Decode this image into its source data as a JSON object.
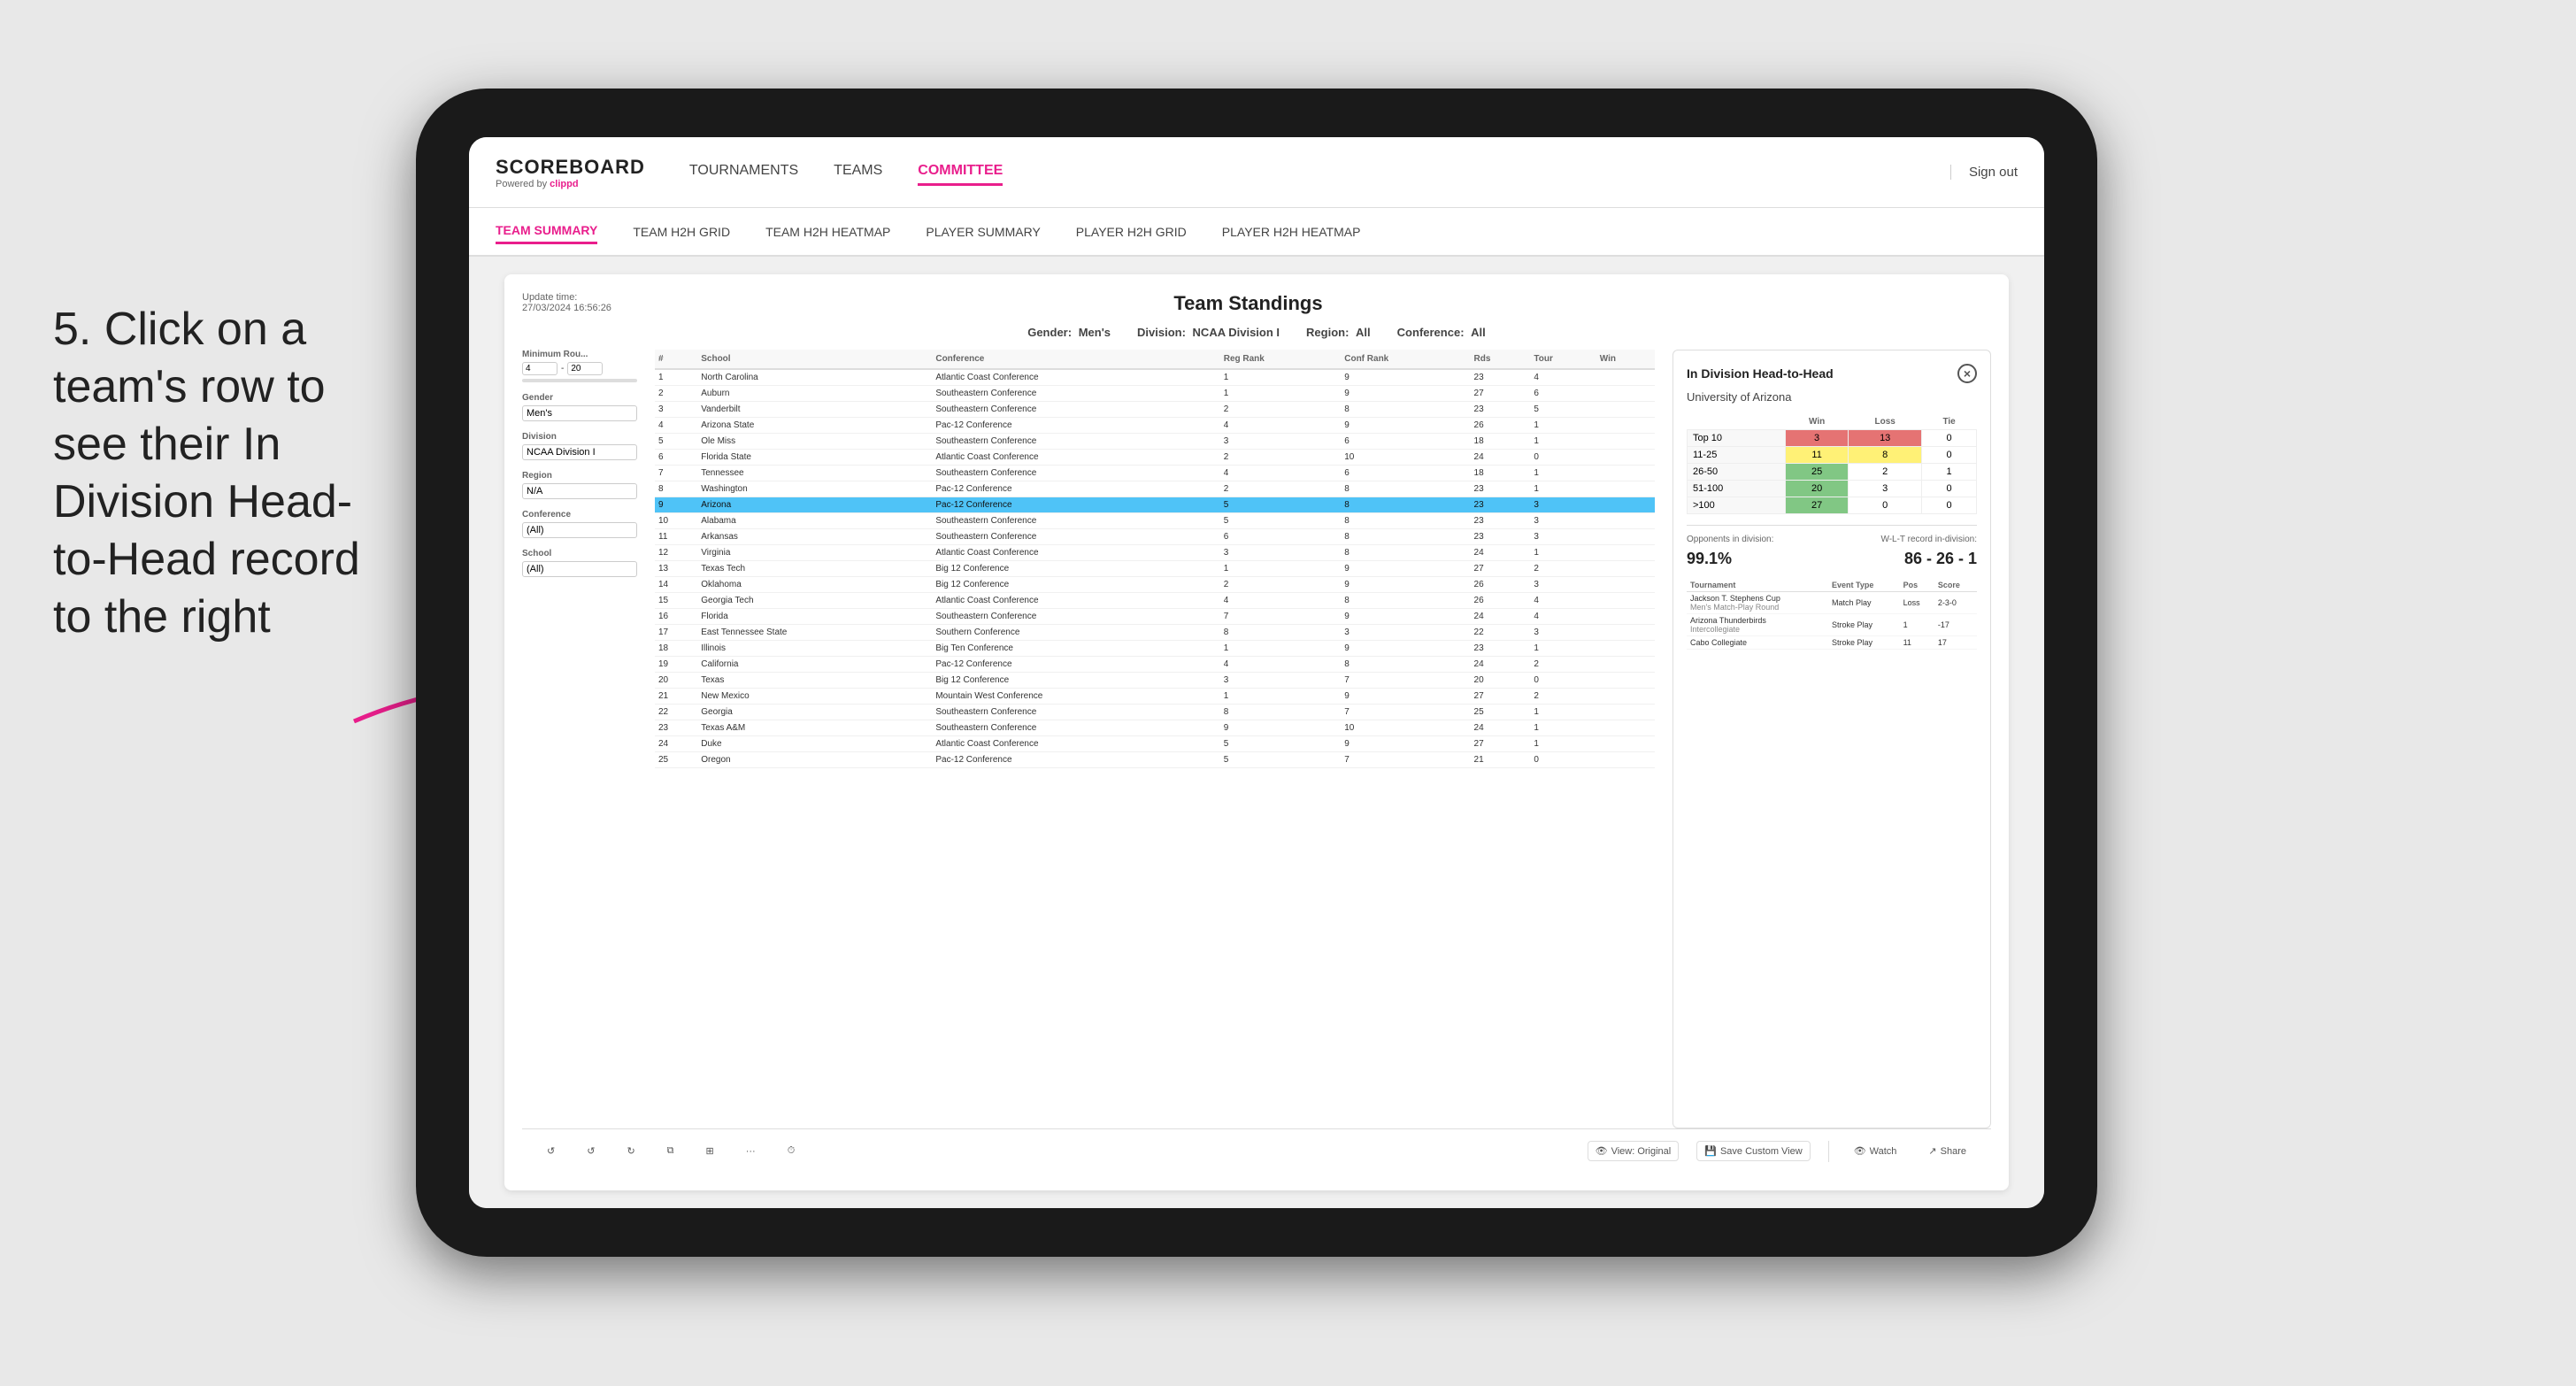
{
  "page": {
    "background_color": "#e8e8e8"
  },
  "instruction": {
    "text": "5. Click on a team's row to see their In Division Head-to-Head record to the right"
  },
  "app": {
    "logo": {
      "title": "SCOREBOARD",
      "subtitle": "Powered by clippd"
    },
    "nav": {
      "items": [
        {
          "label": "TOURNAMENTS",
          "active": false
        },
        {
          "label": "TEAMS",
          "active": false
        },
        {
          "label": "COMMITTEE",
          "active": true
        }
      ],
      "sign_out": "Sign out"
    },
    "sub_nav": {
      "items": [
        {
          "label": "TEAM SUMMARY",
          "active": true
        },
        {
          "label": "TEAM H2H GRID",
          "active": false
        },
        {
          "label": "TEAM H2H HEATMAP",
          "active": false
        },
        {
          "label": "PLAYER SUMMARY",
          "active": false
        },
        {
          "label": "PLAYER H2H GRID",
          "active": false
        },
        {
          "label": "PLAYER H2H HEATMAP",
          "active": false
        }
      ]
    }
  },
  "content": {
    "update_time_label": "Update time:",
    "update_time": "27/03/2024 16:56:26",
    "title": "Team Standings",
    "filters": {
      "gender_label": "Gender:",
      "gender": "Men's",
      "division_label": "Division:",
      "division": "NCAA Division I",
      "region_label": "Region:",
      "region": "All",
      "conference_label": "Conference:",
      "conference": "All"
    },
    "sidebar": {
      "min_rounds_label": "Minimum Rou...",
      "min_rounds_value": "4",
      "min_rounds_max": "20",
      "gender_label": "Gender",
      "gender_value": "Men's",
      "division_label": "Division",
      "division_value": "NCAA Division I",
      "region_label": "Region",
      "region_value": "N/A",
      "conference_label": "Conference",
      "conference_value": "(All)",
      "school_label": "School",
      "school_value": "(All)"
    },
    "table": {
      "headers": [
        "#",
        "School",
        "Conference",
        "Reg Rank",
        "Conf Rank",
        "Rds",
        "Tour",
        "Win"
      ],
      "rows": [
        {
          "num": "1",
          "school": "North Carolina",
          "conference": "Atlantic Coast Conference",
          "reg_rank": "1",
          "conf_rank": "9",
          "rds": "23",
          "tour": "4",
          "win": "",
          "highlighted": false
        },
        {
          "num": "2",
          "school": "Auburn",
          "conference": "Southeastern Conference",
          "reg_rank": "1",
          "conf_rank": "9",
          "rds": "27",
          "tour": "6",
          "win": "",
          "highlighted": false
        },
        {
          "num": "3",
          "school": "Vanderbilt",
          "conference": "Southeastern Conference",
          "reg_rank": "2",
          "conf_rank": "8",
          "rds": "23",
          "tour": "5",
          "win": "",
          "highlighted": false
        },
        {
          "num": "4",
          "school": "Arizona State",
          "conference": "Pac-12 Conference",
          "reg_rank": "4",
          "conf_rank": "9",
          "rds": "26",
          "tour": "1",
          "win": "",
          "highlighted": false
        },
        {
          "num": "5",
          "school": "Ole Miss",
          "conference": "Southeastern Conference",
          "reg_rank": "3",
          "conf_rank": "6",
          "rds": "18",
          "tour": "1",
          "win": "",
          "highlighted": false
        },
        {
          "num": "6",
          "school": "Florida State",
          "conference": "Atlantic Coast Conference",
          "reg_rank": "2",
          "conf_rank": "10",
          "rds": "24",
          "tour": "0",
          "win": "",
          "highlighted": false
        },
        {
          "num": "7",
          "school": "Tennessee",
          "conference": "Southeastern Conference",
          "reg_rank": "4",
          "conf_rank": "6",
          "rds": "18",
          "tour": "1",
          "win": "",
          "highlighted": false
        },
        {
          "num": "8",
          "school": "Washington",
          "conference": "Pac-12 Conference",
          "reg_rank": "2",
          "conf_rank": "8",
          "rds": "23",
          "tour": "1",
          "win": "",
          "highlighted": false
        },
        {
          "num": "9",
          "school": "Arizona",
          "conference": "Pac-12 Conference",
          "reg_rank": "5",
          "conf_rank": "8",
          "rds": "23",
          "tour": "3",
          "win": "",
          "highlighted": true
        },
        {
          "num": "10",
          "school": "Alabama",
          "conference": "Southeastern Conference",
          "reg_rank": "5",
          "conf_rank": "8",
          "rds": "23",
          "tour": "3",
          "win": "",
          "highlighted": false
        },
        {
          "num": "11",
          "school": "Arkansas",
          "conference": "Southeastern Conference",
          "reg_rank": "6",
          "conf_rank": "8",
          "rds": "23",
          "tour": "3",
          "win": "",
          "highlighted": false
        },
        {
          "num": "12",
          "school": "Virginia",
          "conference": "Atlantic Coast Conference",
          "reg_rank": "3",
          "conf_rank": "8",
          "rds": "24",
          "tour": "1",
          "win": "",
          "highlighted": false
        },
        {
          "num": "13",
          "school": "Texas Tech",
          "conference": "Big 12 Conference",
          "reg_rank": "1",
          "conf_rank": "9",
          "rds": "27",
          "tour": "2",
          "win": "",
          "highlighted": false
        },
        {
          "num": "14",
          "school": "Oklahoma",
          "conference": "Big 12 Conference",
          "reg_rank": "2",
          "conf_rank": "9",
          "rds": "26",
          "tour": "3",
          "win": "",
          "highlighted": false
        },
        {
          "num": "15",
          "school": "Georgia Tech",
          "conference": "Atlantic Coast Conference",
          "reg_rank": "4",
          "conf_rank": "8",
          "rds": "26",
          "tour": "4",
          "win": "",
          "highlighted": false
        },
        {
          "num": "16",
          "school": "Florida",
          "conference": "Southeastern Conference",
          "reg_rank": "7",
          "conf_rank": "9",
          "rds": "24",
          "tour": "4",
          "win": "",
          "highlighted": false
        },
        {
          "num": "17",
          "school": "East Tennessee State",
          "conference": "Southern Conference",
          "reg_rank": "8",
          "conf_rank": "3",
          "rds": "22",
          "tour": "3",
          "win": "",
          "highlighted": false
        },
        {
          "num": "18",
          "school": "Illinois",
          "conference": "Big Ten Conference",
          "reg_rank": "1",
          "conf_rank": "9",
          "rds": "23",
          "tour": "1",
          "win": "",
          "highlighted": false
        },
        {
          "num": "19",
          "school": "California",
          "conference": "Pac-12 Conference",
          "reg_rank": "4",
          "conf_rank": "8",
          "rds": "24",
          "tour": "2",
          "win": "",
          "highlighted": false
        },
        {
          "num": "20",
          "school": "Texas",
          "conference": "Big 12 Conference",
          "reg_rank": "3",
          "conf_rank": "7",
          "rds": "20",
          "tour": "0",
          "win": "",
          "highlighted": false
        },
        {
          "num": "21",
          "school": "New Mexico",
          "conference": "Mountain West Conference",
          "reg_rank": "1",
          "conf_rank": "9",
          "rds": "27",
          "tour": "2",
          "win": "",
          "highlighted": false
        },
        {
          "num": "22",
          "school": "Georgia",
          "conference": "Southeastern Conference",
          "reg_rank": "8",
          "conf_rank": "7",
          "rds": "25",
          "tour": "1",
          "win": "",
          "highlighted": false
        },
        {
          "num": "23",
          "school": "Texas A&M",
          "conference": "Southeastern Conference",
          "reg_rank": "9",
          "conf_rank": "10",
          "rds": "24",
          "tour": "1",
          "win": "",
          "highlighted": false
        },
        {
          "num": "24",
          "school": "Duke",
          "conference": "Atlantic Coast Conference",
          "reg_rank": "5",
          "conf_rank": "9",
          "rds": "27",
          "tour": "1",
          "win": "",
          "highlighted": false
        },
        {
          "num": "25",
          "school": "Oregon",
          "conference": "Pac-12 Conference",
          "reg_rank": "5",
          "conf_rank": "7",
          "rds": "21",
          "tour": "0",
          "win": "",
          "highlighted": false
        }
      ]
    },
    "h2h_panel": {
      "title": "In Division Head-to-Head",
      "team_name": "University of Arizona",
      "close_btn": "×",
      "table_headers": [
        "",
        "Win",
        "Loss",
        "Tie"
      ],
      "table_rows": [
        {
          "label": "Top 10",
          "win": "3",
          "loss": "13",
          "tie": "0",
          "win_color": "green",
          "loss_color": "red",
          "tie_color": ""
        },
        {
          "label": "11-25",
          "win": "11",
          "loss": "8",
          "tie": "0",
          "win_color": "yellow",
          "loss_color": "yellow",
          "tie_color": ""
        },
        {
          "label": "26-50",
          "win": "25",
          "loss": "2",
          "tie": "1",
          "win_color": "green-light",
          "loss_color": "",
          "tie_color": ""
        },
        {
          "label": "51-100",
          "win": "20",
          "loss": "3",
          "tie": "0",
          "win_color": "green-light",
          "loss_color": "",
          "tie_color": ""
        },
        {
          "label": ">100",
          "win": "27",
          "loss": "0",
          "tie": "0",
          "win_color": "green-dark",
          "loss_color": "",
          "tie_color": ""
        }
      ],
      "opponents_label": "Opponents in division:",
      "opponents_value": "99.1%",
      "record_label": "W-L-T record in-division:",
      "record_value": "86 - 26 - 1",
      "tournament_headers": [
        "Tournament",
        "Event Type",
        "Pos",
        "Score"
      ],
      "tournament_rows": [
        {
          "name": "Jackson T. Stephens Cup",
          "sub": "Men's Match-Play Round",
          "event_type": "Match Play",
          "pos": "Loss",
          "score": "2-3-0"
        },
        {
          "name": "Arizona Thunderbirds Intercollegiate",
          "sub": "",
          "event_type": "Stroke Play",
          "pos": "1",
          "score": "-17"
        },
        {
          "name": "Cabo Collegiate",
          "sub": "",
          "event_type": "Stroke Play",
          "pos": "11",
          "score": "17"
        }
      ]
    },
    "toolbar": {
      "undo": "↺",
      "redo": "↻",
      "step_back": "⟨",
      "step_fwd": "⟩",
      "copy": "⧉",
      "paste": "⊞",
      "timer": "⏱",
      "view_original": "View: Original",
      "save_custom": "Save Custom View",
      "watch": "Watch",
      "share": "Share"
    }
  }
}
